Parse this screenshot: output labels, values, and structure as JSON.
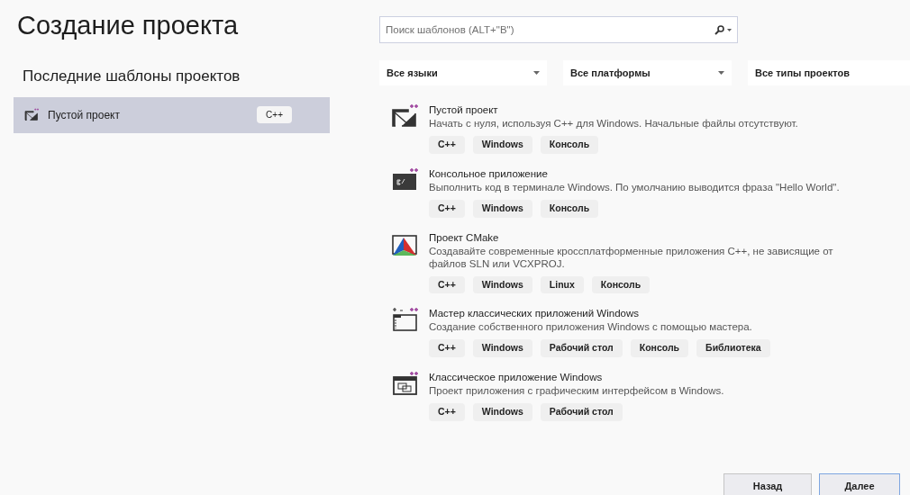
{
  "title": "Создание проекта",
  "recent": {
    "heading": "Последние шаблоны проектов",
    "items": [
      {
        "name": "Пустой проект",
        "tag": "C++",
        "kind": "empty",
        "selected": true
      }
    ]
  },
  "search": {
    "placeholder": "Поиск шаблонов (ALT+\"В\")"
  },
  "filters": [
    {
      "label": "Все языки",
      "caret": true
    },
    {
      "label": "Все платформы",
      "caret": true
    },
    {
      "label": "Все типы проектов",
      "caret": false
    }
  ],
  "templates": [
    {
      "kind": "empty",
      "name": "Пустой проект",
      "description": "Начать с нуля, используя C++ для Windows. Начальные файлы отсутствуют.",
      "tags": [
        "C++",
        "Windows",
        "Консоль"
      ]
    },
    {
      "kind": "console",
      "name": "Консольное приложение",
      "description": "Выполнить код в терминале Windows. По умолчанию выводится фраза \"Hello World\".",
      "tags": [
        "C++",
        "Windows",
        "Консоль"
      ]
    },
    {
      "kind": "cmake",
      "name": "Проект CMake",
      "description": "Создавайте современные кроссплатформенные приложения C++, не зависящие от файлов SLN или VCXPROJ.",
      "tags": [
        "C++",
        "Windows",
        "Linux",
        "Консоль"
      ]
    },
    {
      "kind": "wizard",
      "name": "Мастер классических приложений Windows",
      "description": "Создание собственного приложения Windows с помощью мастера.",
      "tags": [
        "C++",
        "Windows",
        "Рабочий стол",
        "Консоль",
        "Библиотека"
      ]
    },
    {
      "kind": "desktop",
      "name": "Классическое приложение Windows",
      "description": "Проект приложения с графическим интерфейсом в Windows.",
      "tags": [
        "C++",
        "Windows",
        "Рабочий стол"
      ]
    }
  ],
  "buttons": [
    {
      "label": "Назад",
      "default": false
    },
    {
      "label": "Далее",
      "default": true
    }
  ]
}
